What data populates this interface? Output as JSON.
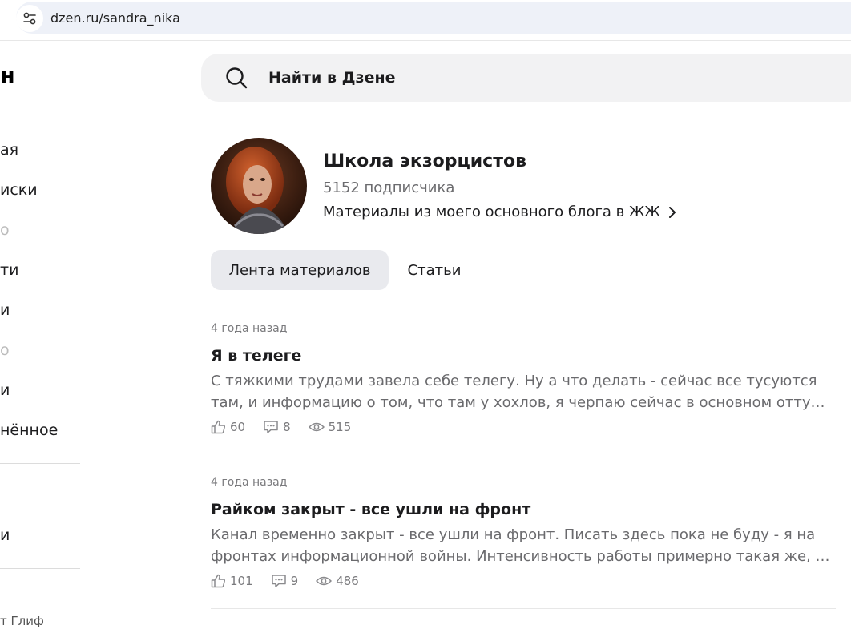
{
  "browser": {
    "url": "dzen.ru/sandra_nika"
  },
  "sidebar": {
    "logo": "н",
    "items": [
      {
        "label": "ая"
      },
      {
        "label": "иски"
      },
      {
        "label": "о"
      },
      {
        "label": "ти"
      },
      {
        "label": "и"
      },
      {
        "label": "о"
      },
      {
        "label": "и"
      },
      {
        "label": "нённое"
      },
      {
        "label": "и"
      }
    ],
    "footer": "т Глиф"
  },
  "search": {
    "placeholder": "Найти в Дзене"
  },
  "channel": {
    "title": "Школа экзорцистов",
    "subscribers": "5152 подписчика",
    "description": "Материалы из моего основного блога в ЖЖ"
  },
  "tabs": [
    {
      "label": "Лента материалов",
      "active": true
    },
    {
      "label": "Статьи",
      "active": false
    }
  ],
  "posts": [
    {
      "time": "4 года назад",
      "title": "Я в телеге",
      "text_line1": "С тяжкими трудами завела себе телегу. Ну а что делать - сейчас все тусуются",
      "text_line2": "там, и информацию о том, что там у хохлов, я черпаю сейчас в основном оттуда. Там",
      "likes": "60",
      "comments": "8",
      "views": "515"
    },
    {
      "time": "4 года назад",
      "title": "Райком закрыт - все ушли на фронт",
      "text_line1": "Канал временно закрыт - все ушли на фронт. Писать здесь пока не буду - я на",
      "text_line2": "фронтах информационной войны. Интенсивность работы примерно такая же, как",
      "likes": "101",
      "comments": "9",
      "views": "486"
    }
  ],
  "colors": {
    "accent_bg": "#e9eaee",
    "search_bg": "#f2f2f3",
    "url_bg": "#eef1f8"
  }
}
